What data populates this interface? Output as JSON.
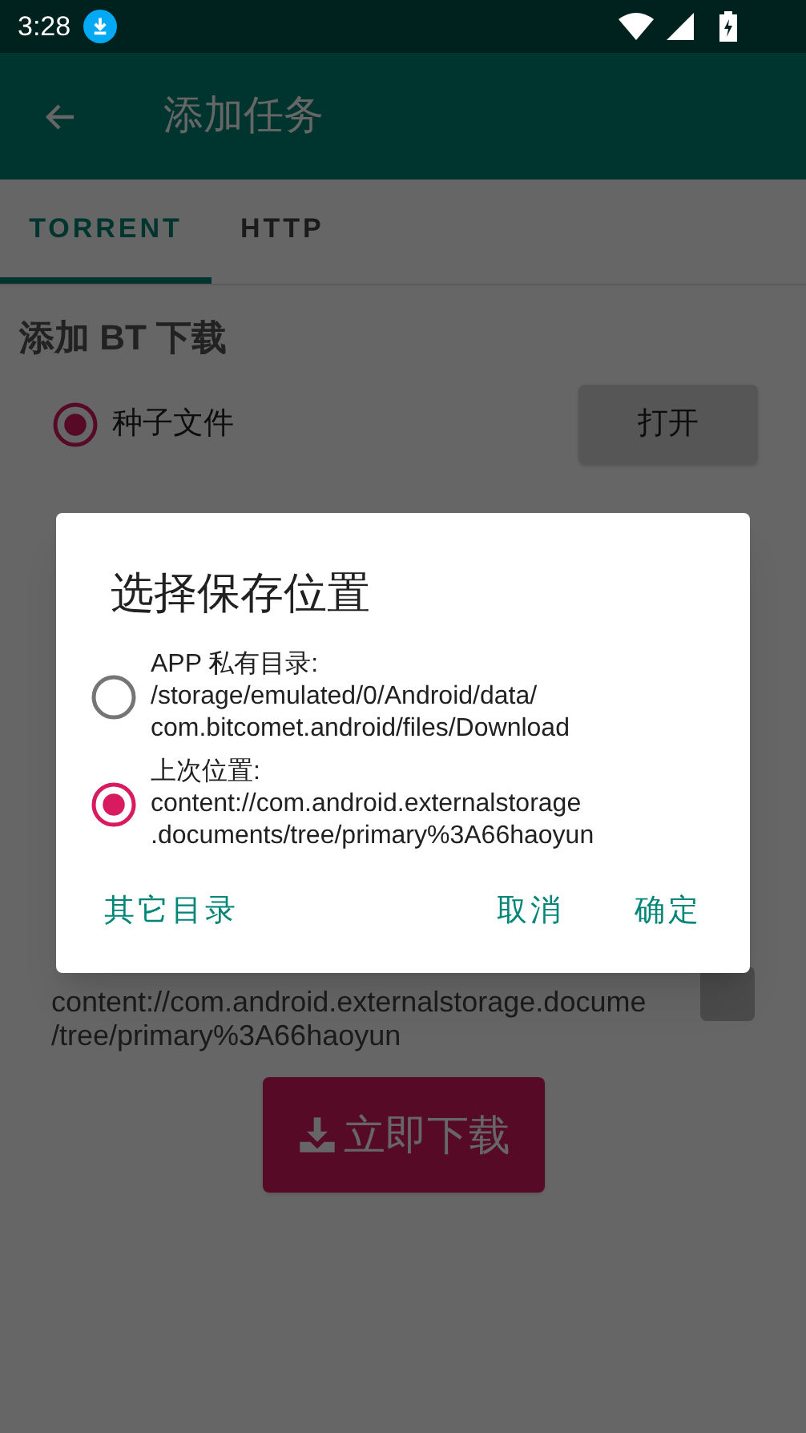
{
  "status_bar": {
    "time": "3:28"
  },
  "app_bar": {
    "title": "添加任务"
  },
  "tabs": [
    {
      "label": "TORRENT",
      "selected": true
    },
    {
      "label": "HTTP",
      "selected": false
    }
  ],
  "section_title": "添加 BT 下载",
  "source": {
    "label": "种子文件",
    "checked": true,
    "button": "打开"
  },
  "save_path": {
    "line_1": "content://com.android.externalstorage.docume",
    "line_2": "/tree/primary%3A66haoyun"
  },
  "download_button": {
    "label": "立即下载"
  },
  "dialog": {
    "title": "选择保存位置",
    "options": [
      {
        "label": "APP 私有目录:",
        "path": "/storage/emulated/0/Android/data/\ncom.bitcomet.android/files/Download",
        "selected": false
      },
      {
        "label": "上次位置:",
        "path": "content://com.android.externalstorage\n.documents/tree/primary%3A66haoyun",
        "selected": true
      }
    ],
    "buttons": [
      "其它目录",
      "取消",
      "确定"
    ]
  }
}
